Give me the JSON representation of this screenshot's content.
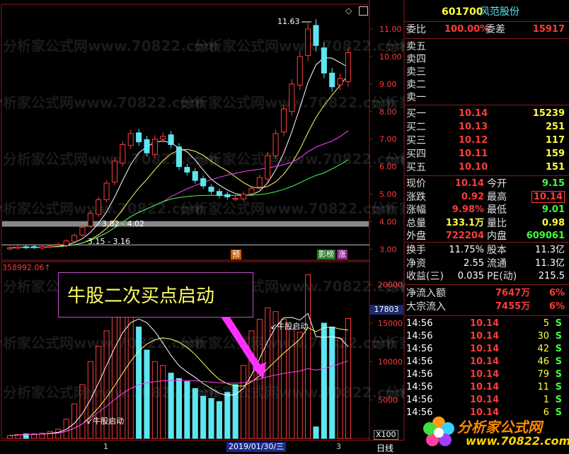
{
  "stock": {
    "code": "601700",
    "name": "风范股份"
  },
  "order_ratio": {
    "label": "委比",
    "value": "100.00%",
    "diff_label": "委差",
    "diff_value": "15917"
  },
  "sell_levels": [
    "卖五",
    "卖四",
    "卖三",
    "卖二",
    "卖一"
  ],
  "buy_levels": [
    {
      "label": "买一",
      "price": "10.14",
      "vol": "15239"
    },
    {
      "label": "买二",
      "price": "10.13",
      "vol": "251"
    },
    {
      "label": "买三",
      "price": "10.12",
      "vol": "117"
    },
    {
      "label": "买四",
      "price": "10.11",
      "vol": "159"
    },
    {
      "label": "买五",
      "price": "10.10",
      "vol": "151"
    }
  ],
  "quote": [
    {
      "l1": "现价",
      "v1": "10.14",
      "l2": "今开",
      "v2": "9.15"
    },
    {
      "l1": "涨跌",
      "v1": "0.92",
      "l2": "最高",
      "v2": "10.14"
    },
    {
      "l1": "涨幅",
      "v1": "9.98%",
      "l2": "最低",
      "v2": "9.01"
    },
    {
      "l1": "总量",
      "v1": "133.1万",
      "l2": "量比",
      "v2": "0.98"
    },
    {
      "l1": "外盘",
      "v1": "722204",
      "l2": "内盘",
      "v2": "609061"
    }
  ],
  "fundamentals": [
    {
      "l1": "换手",
      "v1": "11.75%",
      "l2": "股本",
      "v2": "11.3亿"
    },
    {
      "l1": "净资",
      "v1": "2.55",
      "l2": "流通",
      "v2": "11.3亿"
    },
    {
      "l1": "收益(三)",
      "v1": "0.035",
      "l2": "PE(动)",
      "v2": "215.5"
    }
  ],
  "flows": [
    {
      "label": "净流入额",
      "value": "7647万",
      "pct": "6%"
    },
    {
      "label": "大宗流入",
      "value": "7455万",
      "pct": "6%"
    }
  ],
  "trades": [
    {
      "time": "14:56",
      "price": "10.14",
      "vol": "5",
      "flag": "S"
    },
    {
      "time": "14:56",
      "price": "10.14",
      "vol": "30",
      "flag": "S"
    },
    {
      "time": "14:56",
      "price": "10.14",
      "vol": "42",
      "flag": "S"
    },
    {
      "time": "14:56",
      "price": "10.14",
      "vol": "46",
      "flag": "S"
    },
    {
      "time": "14:56",
      "price": "10.14",
      "vol": "79",
      "flag": "S"
    },
    {
      "time": "14:56",
      "price": "10.14",
      "vol": "11",
      "flag": "S"
    },
    {
      "time": "14:56",
      "price": "10.14",
      "vol": "1",
      "flag": "S"
    },
    {
      "time": "14:56",
      "price": "10.14",
      "vol": "6",
      "flag": "S"
    }
  ],
  "price_axis": [
    "11.00",
    "10.00",
    "9.00",
    "8.00",
    "7.00",
    "6.00",
    "5.00",
    "4.00",
    "3.00"
  ],
  "vol_axis": [
    "20000",
    "15000",
    "10000",
    "5000"
  ],
  "vol_marker": "17803",
  "vol_unit": "X100",
  "vol_peak_label": "358992.06",
  "price_annotations": {
    "high": "11.63",
    "range1": "3.82 - 4.02",
    "range2": "3.15 - 3.16"
  },
  "event_tags": [
    "预",
    "影榜",
    "涨"
  ],
  "banner_text": "牛股二次买点启动",
  "vol_annotations": {
    "upper": "牛股启动",
    "lower": "牛股启动"
  },
  "date_bar": {
    "left_tick": "1",
    "date": "2019/01/30/三",
    "right_tick": "3",
    "mode": "日线"
  },
  "watermark": "分析家公式网www.70822.com",
  "logo": {
    "name": "分析家公式网",
    "url": "www.70822.com"
  },
  "colors": {
    "up": "#ff3b3b",
    "down": "#5ee6f0",
    "ma5": "#ffffff",
    "ma10": "#ffff60",
    "ma20": "#ff40ff",
    "ma60": "#40ff40",
    "grid": "#8b1a1a"
  },
  "chart_data": [
    {
      "type": "candlestick",
      "ylim": [
        2.6,
        11.9
      ],
      "ytick_labels": [
        "11.00",
        "10.00",
        "9.00",
        "8.00",
        "7.00",
        "6.00",
        "5.00",
        "4.00",
        "3.00"
      ],
      "series": [
        {
          "values": [
            3.05,
            3.08,
            3.06,
            3.07,
            3.1,
            3.12,
            3.18,
            3.3,
            3.5,
            3.8,
            4.3,
            4.8,
            5.4,
            6.2,
            6.8,
            7.2,
            6.9,
            6.5,
            7.0,
            7.1,
            6.8,
            6.0,
            5.8,
            5.5,
            5.3,
            5.1,
            4.95,
            4.9,
            4.85,
            5.0,
            5.2,
            5.6,
            6.4,
            7.2,
            8.1,
            9.0,
            10.0,
            11.0,
            10.4,
            9.4,
            8.9,
            9.2,
            10.14
          ]
        }
      ]
    },
    {
      "type": "bar",
      "ylim": [
        0,
        23000
      ],
      "ytick_labels": [
        "20000",
        "15000",
        "10000",
        "5000"
      ],
      "series": [
        {
          "values": [
            400,
            500,
            600,
            600,
            700,
            900,
            1200,
            2500,
            4500,
            7000,
            10000,
            12000,
            14000,
            15800,
            17000,
            16500,
            14500,
            11500,
            10000,
            9500,
            8500,
            7800,
            7400,
            6500,
            5500,
            5200,
            4800,
            6000,
            7000,
            9500,
            14000,
            15500,
            17000,
            16500,
            15500,
            14200,
            13800,
            21300,
            1500,
            15000,
            14500,
            13000,
            15600
          ]
        }
      ]
    }
  ]
}
